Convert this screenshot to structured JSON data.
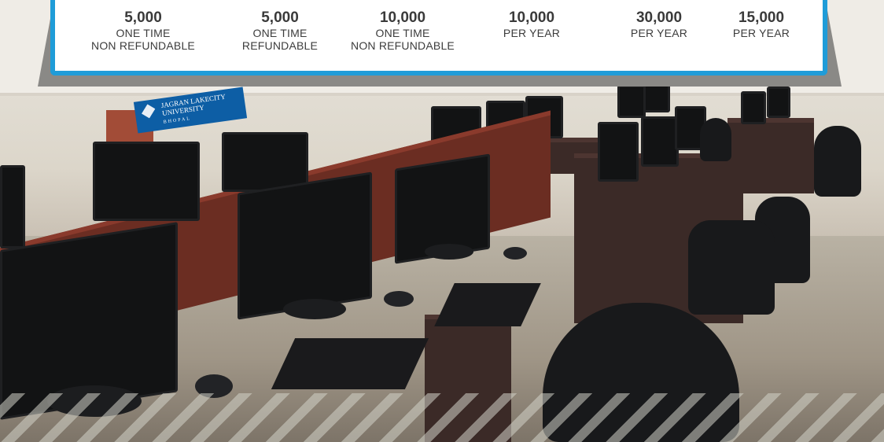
{
  "fees": [
    {
      "amount": "5,000",
      "line1": "ONE TIME",
      "line2": "NON REFUNDABLE"
    },
    {
      "amount": "5,000",
      "line1": "ONE TIME",
      "line2": "REFUNDABLE"
    },
    {
      "amount": "10,000",
      "line1": "ONE TIME",
      "line2": "NON REFUNDABLE"
    },
    {
      "amount": "10,000",
      "line1": "PER YEAR",
      "line2": ""
    },
    {
      "amount": "30,000",
      "line1": "PER YEAR",
      "line2": ""
    },
    {
      "amount": "15,000",
      "line1": "PER YEAR",
      "line2": ""
    }
  ],
  "podium_sign": {
    "line1": "JAGRAN LAKECITY",
    "line2": "UNIVERSITY",
    "line3": "BHOPAL"
  },
  "colors": {
    "card_border": "#1f9cd8",
    "text": "#3c3c3c",
    "desk": "#6b2d22"
  }
}
